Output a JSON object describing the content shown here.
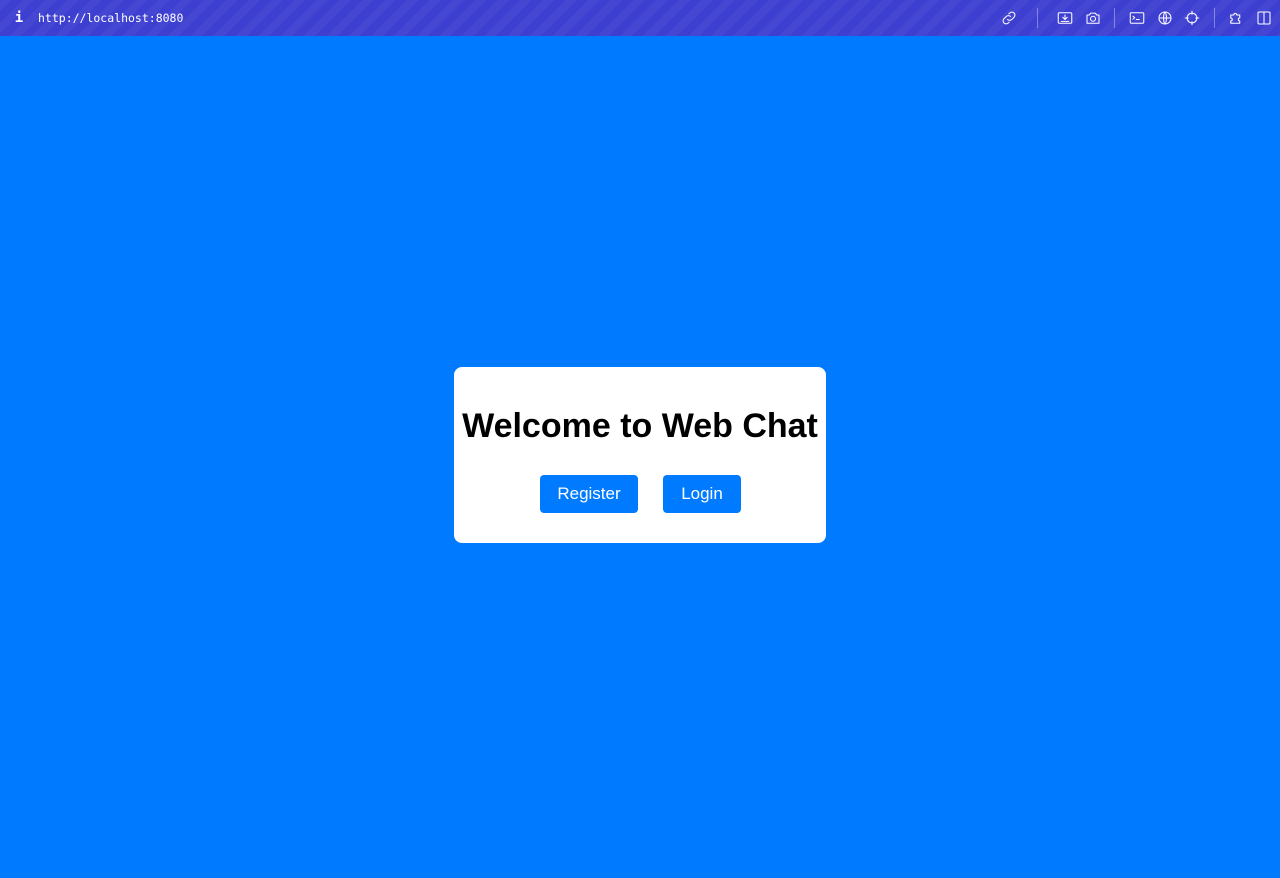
{
  "browser": {
    "url": "http://localhost:8080",
    "info_icon": "i",
    "toolbar_icons": [
      "link-icon",
      "save-page-icon",
      "camera-icon",
      "terminal-icon",
      "globe-icon",
      "crosshair-icon",
      "puzzle-icon",
      "sidebar-icon"
    ],
    "toolbar_color": "#3d3fd1"
  },
  "page": {
    "background_color": "#007bff",
    "title": "Welcome to Web Chat",
    "register_label": "Register",
    "login_label": "Login",
    "button_color": "#007bff"
  }
}
